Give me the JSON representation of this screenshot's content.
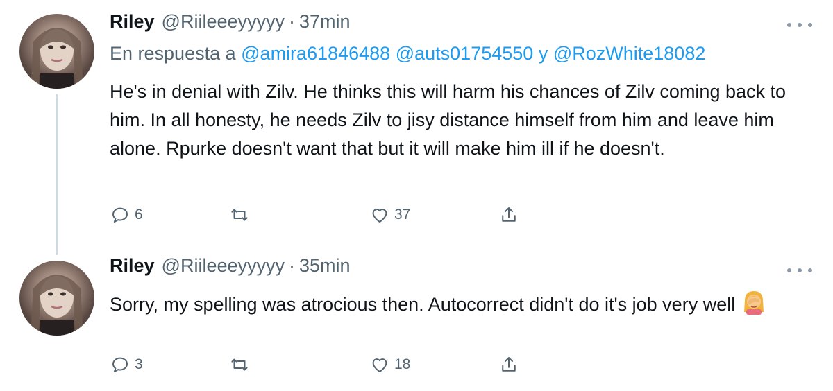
{
  "tweets": [
    {
      "name": "Riley",
      "handle": "@Riileeeyyyyy",
      "separator": "·",
      "time": "37min",
      "reply_to": {
        "prefix": "En respuesta a",
        "mention1": "@amira61846488",
        "mention2": "@auts01754550",
        "joiner": "y",
        "mention3": "@RozWhite18082"
      },
      "text": "He's in denial with Zilv. He thinks this will harm his chances of Zilv coming back to him. In all honesty, he needs Zilv to jisy distance himself from him and leave him alone. Rpurke doesn't want that but it will make him ill if he doesn't.",
      "replies": "6",
      "likes": "37"
    },
    {
      "name": "Riley",
      "handle": "@Riileeeyyyyy",
      "separator": "·",
      "time": "35min",
      "text": "Sorry, my spelling was atrocious then. Autocorrect didn't do it's job very well",
      "emoji": "woman-facepalming",
      "replies": "3",
      "likes": "18"
    }
  ],
  "colors": {
    "text": "#0f1419",
    "secondary": "#536471",
    "mention": "#1d9bf0",
    "thread_line": "#cfd9de"
  },
  "icons": [
    "reply-icon",
    "retweet-icon",
    "like-icon",
    "share-icon",
    "more-icon"
  ]
}
